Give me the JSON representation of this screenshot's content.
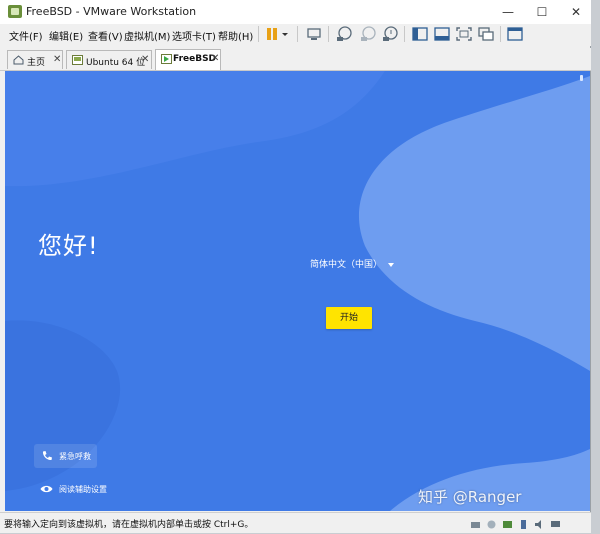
{
  "window": {
    "title": "FreeBSD - VMware Workstation",
    "minimize": "—",
    "maximize": "☐",
    "close": "✕"
  },
  "menubar": {
    "items": [
      {
        "label": "文件(F)"
      },
      {
        "label": "编辑(E)"
      },
      {
        "label": "查看(V)"
      },
      {
        "label": "虚拟机(M)"
      },
      {
        "label": "选项卡(T)"
      },
      {
        "label": "帮助(H)"
      }
    ]
  },
  "toolbar": {
    "icons": [
      "pause-icon",
      "dropdown-icon",
      "send-ctrl-alt-del-icon",
      "snapshot-icon",
      "snapshot-revert-icon",
      "snapshot-manager-icon",
      "library-view-icon",
      "console-view-icon",
      "fullscreen-icon",
      "unity-icon",
      "thumbnail-icon"
    ],
    "accent": "#e8a116"
  },
  "tabs": [
    {
      "label": "主页",
      "close": "✕",
      "active": false
    },
    {
      "label": "Ubuntu 64 位",
      "close": "✕",
      "active": false
    },
    {
      "label": "FreeBSD",
      "close": "✕",
      "active": true
    }
  ],
  "vm": {
    "greeting": "您好!",
    "language": "简体中文（中国）",
    "start_label": "开始",
    "emergency_label": "紧急呼救",
    "accessibility_label": "阅读辅助设置",
    "background_color": "#3f7ae6",
    "button_color": "#ffe400"
  },
  "statusbar": {
    "text": "要将输入定向到该虚拟机，请在虚拟机内部单击或按 Ctrl+G。"
  },
  "watermark": "知乎 @Ranger"
}
